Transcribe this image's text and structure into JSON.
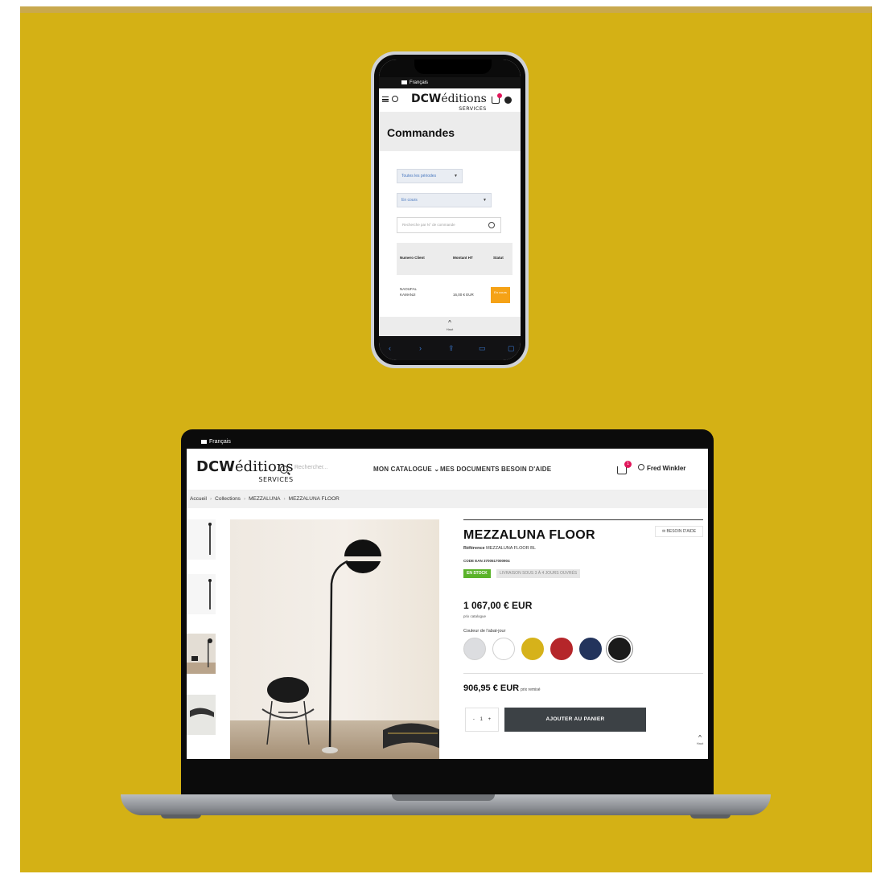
{
  "phone": {
    "language": "Français",
    "logo": {
      "main": "DCW",
      "script": "éditions",
      "sub": "SERVICES"
    },
    "page_title": "Commandes",
    "filters": {
      "period": "Toutes les périodes",
      "status": "En cours",
      "search_placeholder": "Recherche par N° de commande"
    },
    "table": {
      "headers": [
        "Numero Client",
        "Montant HT",
        "Statut"
      ],
      "rows": [
        {
          "client": "NAOUFAL KAMANJI",
          "amount": "16,00 € EUR",
          "status": "En cours"
        }
      ]
    },
    "top_button_label": "Haut",
    "colors": {
      "status_badge": "#f5a216",
      "cart_badge": "#e2165b",
      "link_blue": "#4a79c0"
    }
  },
  "laptop": {
    "language": "Français",
    "logo": {
      "main": "DCW",
      "script": "éditions",
      "sub": "SERVICES"
    },
    "search_placeholder": "Rechercher...",
    "nav": {
      "catalogue": "MON CATALOGUE",
      "documents": "MES DOCUMENTS",
      "help": "BESOIN D'AIDE"
    },
    "cart_count": "1",
    "user_name": "Fred Winkler",
    "breadcrumb": [
      "Accueil",
      "Collections",
      "MEZZALUNA",
      "MEZZALUNA FLOOR"
    ],
    "product": {
      "title": "MEZZALUNA FLOOR",
      "help_button": "BESOIN D'AIDE",
      "reference_label": "Référence",
      "reference_value": "MEZZALUNA FLOOR BL",
      "ean_label": "CODE EAN",
      "ean_value": "3700517000904",
      "stock": "EN STOCK",
      "delivery": "LIVRAISON SOUS 3 À 4 JOURS OUVRÉS",
      "price": "1 067,00 € EUR",
      "price_label": "prix catalogue",
      "color_label": "Couleur de l'abat-jour",
      "swatches": [
        "#dcdde0",
        "#ffffff",
        "#d6b21a",
        "#b5262a",
        "#23345c",
        "#1b1b1b"
      ],
      "net_price": "906,95 € EUR",
      "net_price_label": "prix remisé",
      "quantity": "1",
      "qty_minus": "-",
      "qty_plus": "+",
      "add_to_cart": "AJOUTER AU PANIER"
    },
    "top_button_label": "Haut",
    "colors": {
      "stock_badge": "#5ab32a",
      "add_button": "#3c4145",
      "cart_badge": "#e2165b"
    }
  },
  "background_color": "#d4b115"
}
